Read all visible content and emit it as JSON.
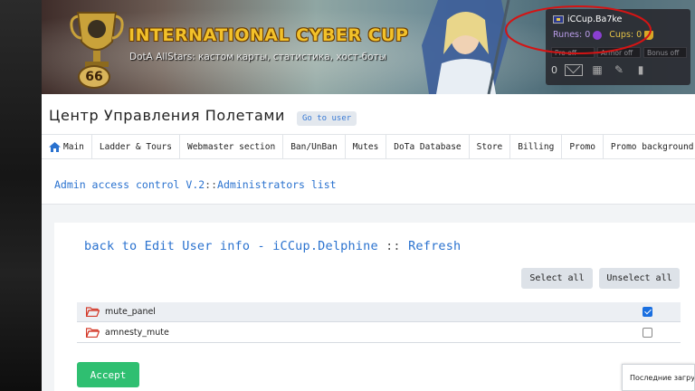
{
  "banner": {
    "brand": "INTERNATIONAL CYBER CUP",
    "tagline": "DotA AllStars: кастом карты, статистика, хост-боты",
    "level": "66"
  },
  "user_panel": {
    "username": "iCCup.Ba7ke",
    "runes_label": "Runes: 0",
    "cups_label": "Cups: 0",
    "toggles": [
      "Pro off",
      "Armor off",
      "Bonus off"
    ],
    "messages_count": "0",
    "icons": [
      "mail-icon",
      "grid-icon",
      "wrench-icon",
      "chart-icon"
    ]
  },
  "header": {
    "title": "Центр Управления Полетами",
    "goto_user": "Go to user"
  },
  "nav": {
    "items": [
      "Main",
      "Ladder & Tours",
      "Webmaster section",
      "Ban/UnBan",
      "Mutes",
      "DoTa Database",
      "Store",
      "Billing",
      "Promo",
      "Promo background"
    ]
  },
  "breadcrumb": {
    "part1": "Admin access control V.2",
    "sep": "::",
    "part2": "Administrators list"
  },
  "card": {
    "back_link": "back to Edit User info - iCCup.Delphine",
    "sep": "::",
    "refresh": "Refresh",
    "select_all": "Select all",
    "unselect_all": "Unselect all",
    "permissions": [
      {
        "name": "mute_panel",
        "checked": true
      },
      {
        "name": "amnesty_mute",
        "checked": false
      }
    ],
    "accept": "Accept"
  },
  "toast": {
    "text": "Последние загрузки"
  },
  "colors": {
    "link": "#2a72cf",
    "accept": "#2fbf71",
    "checkbox": "#1a6fe0",
    "brand_gold": "#f2c12a",
    "annotation_red": "#d41414"
  }
}
